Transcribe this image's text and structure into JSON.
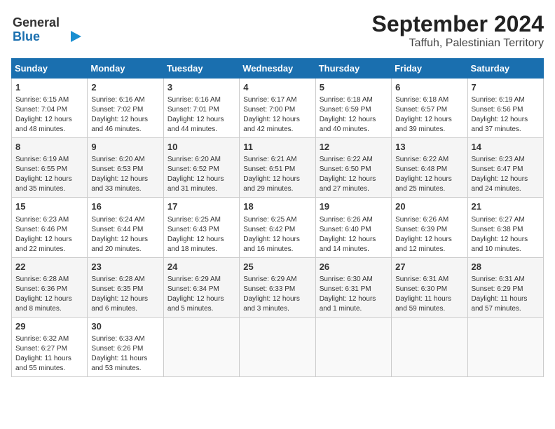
{
  "logo": {
    "line1": "General",
    "line2": "Blue"
  },
  "title": "September 2024",
  "location": "Taffuh, Palestinian Territory",
  "weekdays": [
    "Sunday",
    "Monday",
    "Tuesday",
    "Wednesday",
    "Thursday",
    "Friday",
    "Saturday"
  ],
  "weeks": [
    [
      {
        "day": "1",
        "sunrise": "Sunrise: 6:15 AM",
        "sunset": "Sunset: 7:04 PM",
        "daylight": "Daylight: 12 hours and 48 minutes."
      },
      {
        "day": "2",
        "sunrise": "Sunrise: 6:16 AM",
        "sunset": "Sunset: 7:02 PM",
        "daylight": "Daylight: 12 hours and 46 minutes."
      },
      {
        "day": "3",
        "sunrise": "Sunrise: 6:16 AM",
        "sunset": "Sunset: 7:01 PM",
        "daylight": "Daylight: 12 hours and 44 minutes."
      },
      {
        "day": "4",
        "sunrise": "Sunrise: 6:17 AM",
        "sunset": "Sunset: 7:00 PM",
        "daylight": "Daylight: 12 hours and 42 minutes."
      },
      {
        "day": "5",
        "sunrise": "Sunrise: 6:18 AM",
        "sunset": "Sunset: 6:59 PM",
        "daylight": "Daylight: 12 hours and 40 minutes."
      },
      {
        "day": "6",
        "sunrise": "Sunrise: 6:18 AM",
        "sunset": "Sunset: 6:57 PM",
        "daylight": "Daylight: 12 hours and 39 minutes."
      },
      {
        "day": "7",
        "sunrise": "Sunrise: 6:19 AM",
        "sunset": "Sunset: 6:56 PM",
        "daylight": "Daylight: 12 hours and 37 minutes."
      }
    ],
    [
      {
        "day": "8",
        "sunrise": "Sunrise: 6:19 AM",
        "sunset": "Sunset: 6:55 PM",
        "daylight": "Daylight: 12 hours and 35 minutes."
      },
      {
        "day": "9",
        "sunrise": "Sunrise: 6:20 AM",
        "sunset": "Sunset: 6:53 PM",
        "daylight": "Daylight: 12 hours and 33 minutes."
      },
      {
        "day": "10",
        "sunrise": "Sunrise: 6:20 AM",
        "sunset": "Sunset: 6:52 PM",
        "daylight": "Daylight: 12 hours and 31 minutes."
      },
      {
        "day": "11",
        "sunrise": "Sunrise: 6:21 AM",
        "sunset": "Sunset: 6:51 PM",
        "daylight": "Daylight: 12 hours and 29 minutes."
      },
      {
        "day": "12",
        "sunrise": "Sunrise: 6:22 AM",
        "sunset": "Sunset: 6:50 PM",
        "daylight": "Daylight: 12 hours and 27 minutes."
      },
      {
        "day": "13",
        "sunrise": "Sunrise: 6:22 AM",
        "sunset": "Sunset: 6:48 PM",
        "daylight": "Daylight: 12 hours and 25 minutes."
      },
      {
        "day": "14",
        "sunrise": "Sunrise: 6:23 AM",
        "sunset": "Sunset: 6:47 PM",
        "daylight": "Daylight: 12 hours and 24 minutes."
      }
    ],
    [
      {
        "day": "15",
        "sunrise": "Sunrise: 6:23 AM",
        "sunset": "Sunset: 6:46 PM",
        "daylight": "Daylight: 12 hours and 22 minutes."
      },
      {
        "day": "16",
        "sunrise": "Sunrise: 6:24 AM",
        "sunset": "Sunset: 6:44 PM",
        "daylight": "Daylight: 12 hours and 20 minutes."
      },
      {
        "day": "17",
        "sunrise": "Sunrise: 6:25 AM",
        "sunset": "Sunset: 6:43 PM",
        "daylight": "Daylight: 12 hours and 18 minutes."
      },
      {
        "day": "18",
        "sunrise": "Sunrise: 6:25 AM",
        "sunset": "Sunset: 6:42 PM",
        "daylight": "Daylight: 12 hours and 16 minutes."
      },
      {
        "day": "19",
        "sunrise": "Sunrise: 6:26 AM",
        "sunset": "Sunset: 6:40 PM",
        "daylight": "Daylight: 12 hours and 14 minutes."
      },
      {
        "day": "20",
        "sunrise": "Sunrise: 6:26 AM",
        "sunset": "Sunset: 6:39 PM",
        "daylight": "Daylight: 12 hours and 12 minutes."
      },
      {
        "day": "21",
        "sunrise": "Sunrise: 6:27 AM",
        "sunset": "Sunset: 6:38 PM",
        "daylight": "Daylight: 12 hours and 10 minutes."
      }
    ],
    [
      {
        "day": "22",
        "sunrise": "Sunrise: 6:28 AM",
        "sunset": "Sunset: 6:36 PM",
        "daylight": "Daylight: 12 hours and 8 minutes."
      },
      {
        "day": "23",
        "sunrise": "Sunrise: 6:28 AM",
        "sunset": "Sunset: 6:35 PM",
        "daylight": "Daylight: 12 hours and 6 minutes."
      },
      {
        "day": "24",
        "sunrise": "Sunrise: 6:29 AM",
        "sunset": "Sunset: 6:34 PM",
        "daylight": "Daylight: 12 hours and 5 minutes."
      },
      {
        "day": "25",
        "sunrise": "Sunrise: 6:29 AM",
        "sunset": "Sunset: 6:33 PM",
        "daylight": "Daylight: 12 hours and 3 minutes."
      },
      {
        "day": "26",
        "sunrise": "Sunrise: 6:30 AM",
        "sunset": "Sunset: 6:31 PM",
        "daylight": "Daylight: 12 hours and 1 minute."
      },
      {
        "day": "27",
        "sunrise": "Sunrise: 6:31 AM",
        "sunset": "Sunset: 6:30 PM",
        "daylight": "Daylight: 11 hours and 59 minutes."
      },
      {
        "day": "28",
        "sunrise": "Sunrise: 6:31 AM",
        "sunset": "Sunset: 6:29 PM",
        "daylight": "Daylight: 11 hours and 57 minutes."
      }
    ],
    [
      {
        "day": "29",
        "sunrise": "Sunrise: 6:32 AM",
        "sunset": "Sunset: 6:27 PM",
        "daylight": "Daylight: 11 hours and 55 minutes."
      },
      {
        "day": "30",
        "sunrise": "Sunrise: 6:33 AM",
        "sunset": "Sunset: 6:26 PM",
        "daylight": "Daylight: 11 hours and 53 minutes."
      },
      null,
      null,
      null,
      null,
      null
    ]
  ]
}
